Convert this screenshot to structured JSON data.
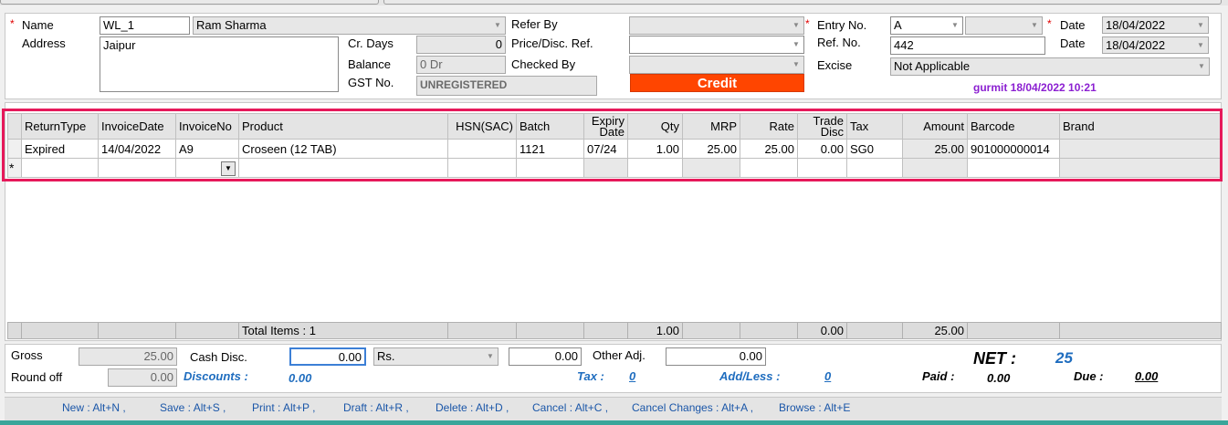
{
  "header": {
    "name_label": "Name",
    "name_code": "WL_1",
    "name_value": "Ram Sharma",
    "address_label": "Address",
    "address_value": "Jaipur",
    "cr_days_label": "Cr. Days",
    "cr_days_value": "0",
    "balance_label": "Balance",
    "balance_value": "0 Dr",
    "gst_label": "GST No.",
    "gst_value": "UNREGISTERED",
    "refer_by_label": "Refer By",
    "refer_by_value": "",
    "price_ref_label": "Price/Disc. Ref.",
    "price_ref_value": "",
    "checked_by_label": "Checked By",
    "checked_by_value": "",
    "credit_label": "Credit",
    "entry_no_label": "Entry No.",
    "entry_no_prefix": "A",
    "entry_no_value": "",
    "ref_no_label": "Ref. No.",
    "ref_no_value": "442",
    "excise_label": "Excise",
    "excise_value": "Not Applicable",
    "date_label": "Date",
    "date_value": "18/04/2022",
    "date2_label": "Date",
    "date2_value": "18/04/2022",
    "user_stamp": "gurmit 18/04/2022 10:21",
    "required_mark": "*"
  },
  "grid": {
    "columns": [
      "ReturnType",
      "InvoiceDate",
      "InvoiceNo",
      "Product",
      "HSN(SAC)",
      "Batch",
      "Expiry Date",
      "Qty",
      "MRP",
      "Rate",
      "Trade Disc",
      "Tax",
      "Amount",
      "Barcode",
      "Brand"
    ],
    "rows": [
      [
        "Expired",
        "14/04/2022",
        "A9",
        "Croseen (12 TAB)",
        "",
        "1121",
        "07/24",
        "1.00",
        "25.00",
        "25.00",
        "0.00",
        "SG0",
        "25.00",
        "901000000014",
        ""
      ]
    ],
    "new_row_marker": "*",
    "totals": {
      "label": "Total Items : 1",
      "qty": "1.00",
      "trade_disc": "0.00",
      "amount": "25.00"
    }
  },
  "footer": {
    "gross_label": "Gross",
    "gross_value": "25.00",
    "round_off_label": "Round off",
    "round_off_value": "0.00",
    "cash_disc_label": "Cash Disc.",
    "cash_disc_value": "0.00",
    "cash_disc_unit": "Rs.",
    "cash_disc_amount": "0.00",
    "other_adj_label": "Other Adj.",
    "other_adj_value": "0.00",
    "discounts_label": "Discounts :",
    "discounts_value": "0.00",
    "tax_label": "Tax :",
    "tax_value": "0",
    "add_less_label": "Add/Less :",
    "add_less_value": "0",
    "net_label": "NET :",
    "net_value": "25",
    "paid_label": "Paid :",
    "paid_value": "0.00",
    "due_label": "Due :",
    "due_value": "0.00"
  },
  "shortcuts": [
    "New : Alt+N ,",
    "Save : Alt+S ,",
    "Print : Alt+P ,",
    "Draft : Alt+R ,",
    "Delete : Alt+D ,",
    "Cancel : Alt+C ,",
    "Cancel Changes : Alt+A ,",
    "Browse : Alt+E"
  ],
  "colors": {
    "credit_button": "#ff4500",
    "highlight_border": "#e6195a",
    "user_stamp": "#8b1fd1",
    "accent_blue": "#1f6dbf"
  }
}
